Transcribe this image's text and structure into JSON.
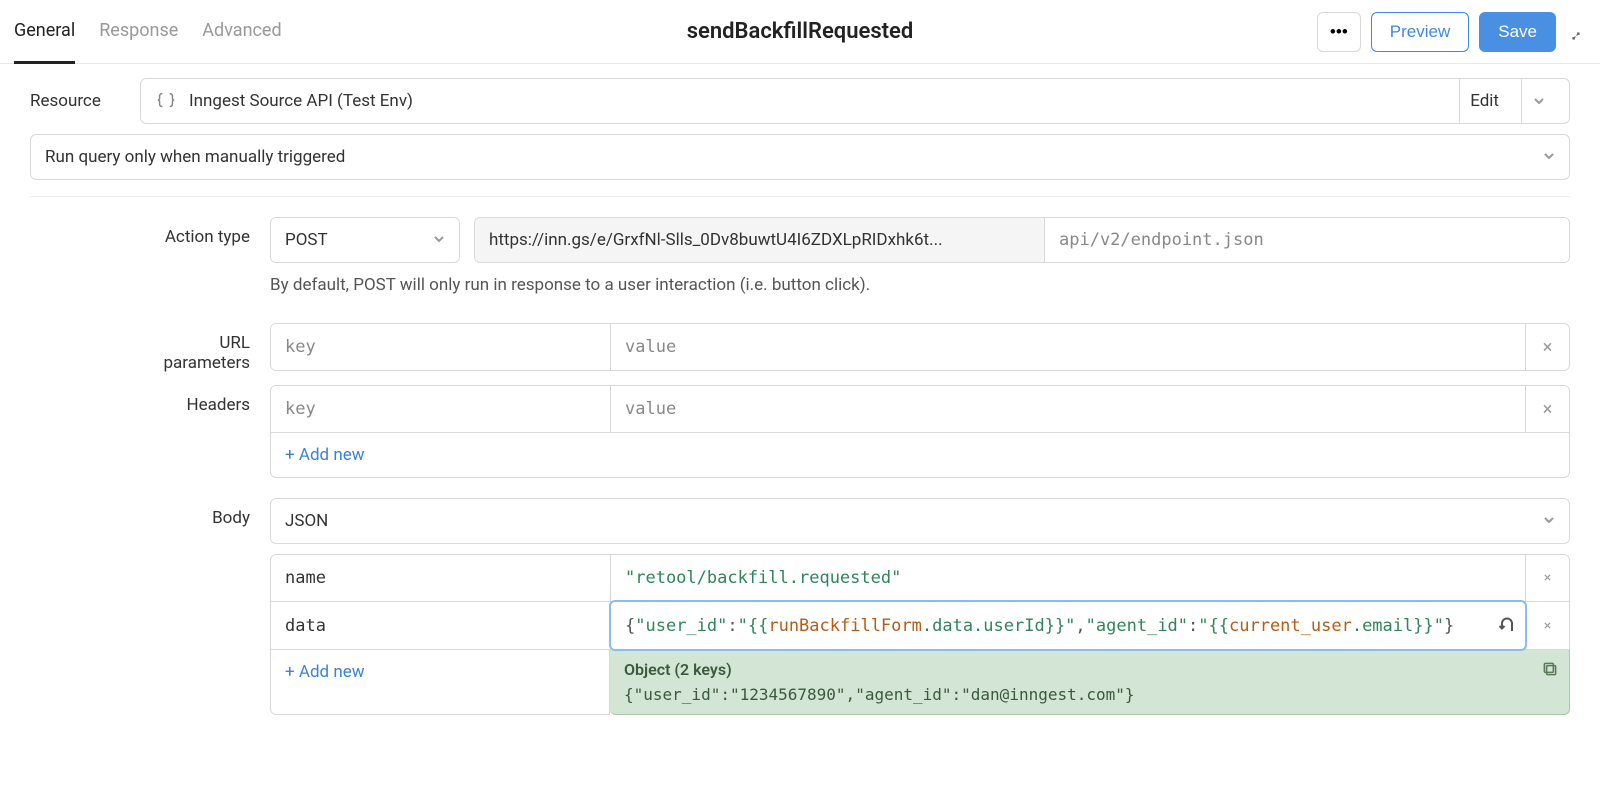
{
  "tabs": {
    "general": "General",
    "response": "Response",
    "advanced": "Advanced",
    "active": "general"
  },
  "title": "sendBackfillRequested",
  "buttons": {
    "more": "...",
    "preview": "Preview",
    "save": "Save"
  },
  "resource": {
    "label": "Resource",
    "name": "Inngest Source API (Test Env)",
    "edit": "Edit"
  },
  "trigger": {
    "value": "Run query only when manually triggered"
  },
  "action": {
    "label": "Action type",
    "method": "POST",
    "base_url": "https://inn.gs/e/GrxfNl-Slls_0Dv8buwtU4I6ZDXLpRIDxhk6t...",
    "url_placeholder": "api/v2/endpoint.json",
    "helper": "By default, POST will only run in response to a user interaction (i.e. button click)."
  },
  "url_params": {
    "label": "URL parameters",
    "key_placeholder": "key",
    "value_placeholder": "value"
  },
  "headers": {
    "label": "Headers",
    "key_placeholder": "key",
    "value_placeholder": "value",
    "add_new": "+ Add new"
  },
  "body": {
    "label": "Body",
    "type": "JSON",
    "rows": {
      "name": {
        "key": "name",
        "value_str": "\"retool/backfill.requested\""
      },
      "data": {
        "key": "data",
        "prefix": "{ ",
        "k1": "\"user_id\"",
        "sep": ": ",
        "t1a": "\"{{",
        "t1b": "runBackfillForm",
        "t1c": ".data.userId",
        "t1d": "}}\"",
        "comma": ", ",
        "k2": "\"agent_id\"",
        "t2a": "\"{{",
        "t2b": "current_user",
        "t2c": ".email",
        "t2d": "}}\"",
        "suffix": " }"
      }
    },
    "add_new": "+ Add new"
  },
  "eval": {
    "head": "Object (2 keys)",
    "json": "{\"user_id\":\"1234567890\",\"agent_id\":\"dan@inngest.com\"}"
  }
}
